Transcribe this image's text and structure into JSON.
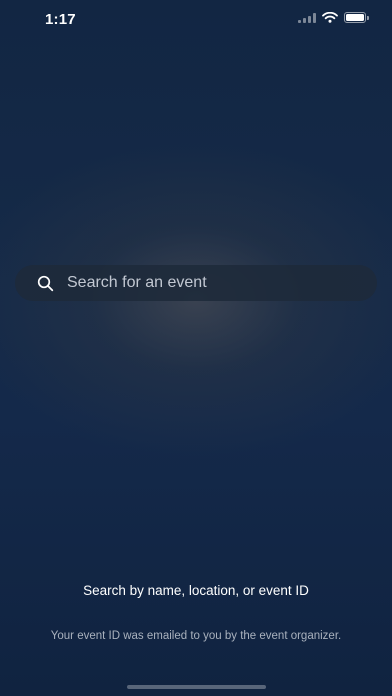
{
  "status_bar": {
    "time": "1:17",
    "icons": [
      "signal-icon",
      "wifi-icon",
      "battery-icon"
    ]
  },
  "search": {
    "placeholder": "Search for an event",
    "value": "",
    "icon": "search-icon"
  },
  "hint": {
    "title": "Search by name, location, or event ID",
    "body": "Your event ID was emailed to you by the event organizer."
  },
  "colors": {
    "background": "#14294a",
    "search_bar": "#1e2a3a",
    "placeholder": "#c2c8d2",
    "secondary_text": "#a9b1bd"
  }
}
